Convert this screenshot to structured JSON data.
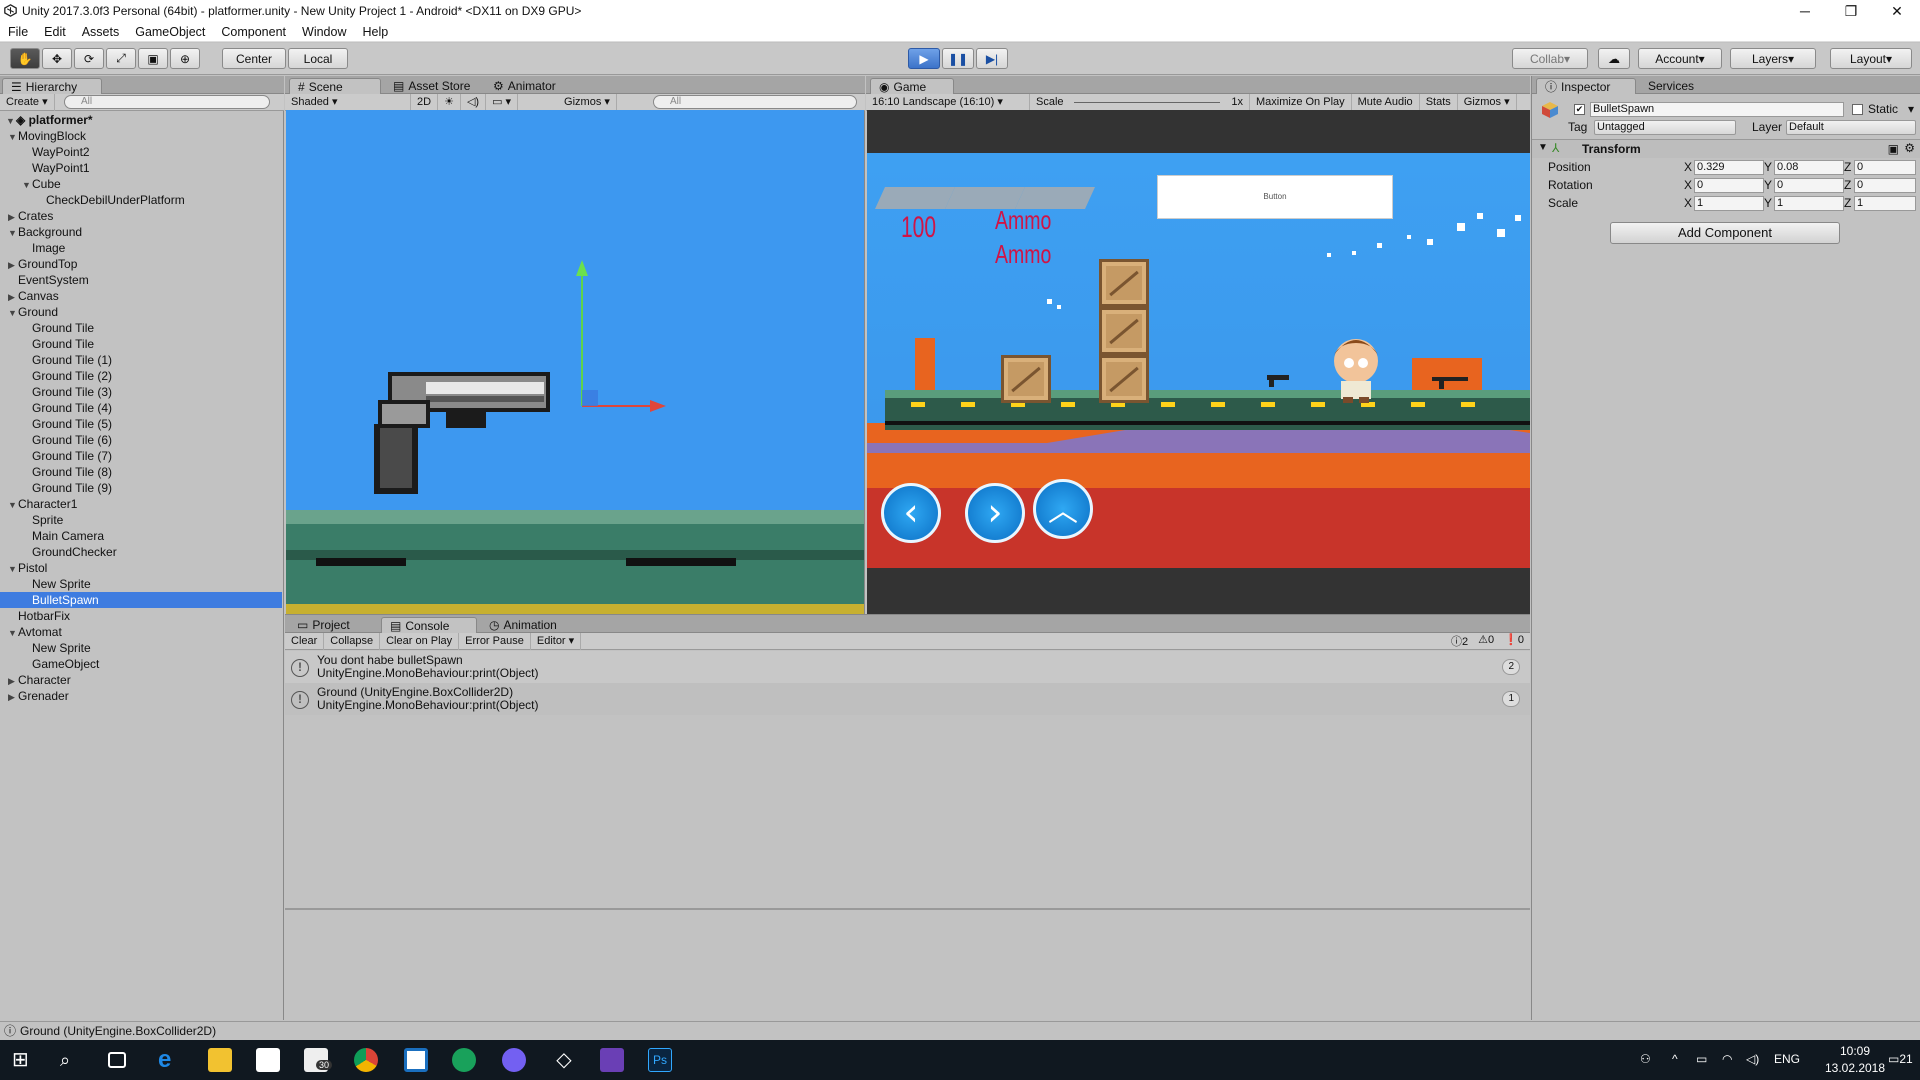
{
  "window": {
    "title": "Unity 2017.3.0f3 Personal (64bit) - platformer.unity - New Unity Project 1 - Android* <DX11 on DX9 GPU>",
    "controls": [
      "─",
      "❐",
      "✕"
    ]
  },
  "menu": [
    "File",
    "Edit",
    "Assets",
    "GameObject",
    "Component",
    "Window",
    "Help"
  ],
  "toolbar": {
    "pivot": "Center",
    "space": "Local",
    "collab": "Collab",
    "account": "Account",
    "layers": "Layers",
    "layout": "Layout"
  },
  "hierarchy": {
    "tab": "Hierarchy",
    "create": "Create",
    "search_placeholder": "All",
    "scene_name": "platformer*",
    "items": [
      {
        "label": "MovingBlock",
        "depth": 1,
        "arrow": "down"
      },
      {
        "label": "WayPoint2",
        "depth": 2,
        "arrow": ""
      },
      {
        "label": "WayPoint1",
        "depth": 2,
        "arrow": ""
      },
      {
        "label": "Cube",
        "depth": 2,
        "arrow": "down"
      },
      {
        "label": "CheckDebilUnderPlatform",
        "depth": 3,
        "arrow": ""
      },
      {
        "label": "Crates",
        "depth": 1,
        "arrow": "right"
      },
      {
        "label": "Background",
        "depth": 1,
        "arrow": "down"
      },
      {
        "label": "Image",
        "depth": 2,
        "arrow": ""
      },
      {
        "label": "GroundTop",
        "depth": 1,
        "arrow": "right"
      },
      {
        "label": "EventSystem",
        "depth": 1,
        "arrow": ""
      },
      {
        "label": "Canvas",
        "depth": 1,
        "arrow": "right"
      },
      {
        "label": "Ground",
        "depth": 1,
        "arrow": "down"
      },
      {
        "label": "Ground Tile",
        "depth": 2,
        "arrow": ""
      },
      {
        "label": "Ground Tile",
        "depth": 2,
        "arrow": ""
      },
      {
        "label": "Ground Tile (1)",
        "depth": 2,
        "arrow": ""
      },
      {
        "label": "Ground Tile (2)",
        "depth": 2,
        "arrow": ""
      },
      {
        "label": "Ground Tile (3)",
        "depth": 2,
        "arrow": ""
      },
      {
        "label": "Ground Tile (4)",
        "depth": 2,
        "arrow": ""
      },
      {
        "label": "Ground Tile (5)",
        "depth": 2,
        "arrow": ""
      },
      {
        "label": "Ground Tile (6)",
        "depth": 2,
        "arrow": ""
      },
      {
        "label": "Ground Tile (7)",
        "depth": 2,
        "arrow": ""
      },
      {
        "label": "Ground Tile (8)",
        "depth": 2,
        "arrow": ""
      },
      {
        "label": "Ground Tile (9)",
        "depth": 2,
        "arrow": ""
      },
      {
        "label": "Character1",
        "depth": 1,
        "arrow": "down"
      },
      {
        "label": "Sprite",
        "depth": 2,
        "arrow": ""
      },
      {
        "label": "Main Camera",
        "depth": 2,
        "arrow": ""
      },
      {
        "label": "GroundChecker",
        "depth": 2,
        "arrow": ""
      },
      {
        "label": "Pistol",
        "depth": 1,
        "arrow": "down"
      },
      {
        "label": "New Sprite",
        "depth": 2,
        "arrow": ""
      },
      {
        "label": "BulletSpawn",
        "depth": 2,
        "arrow": "",
        "selected": true
      },
      {
        "label": "HotbarFix",
        "depth": 1,
        "arrow": ""
      },
      {
        "label": "Avtomat",
        "depth": 1,
        "arrow": "down"
      },
      {
        "label": "New Sprite",
        "depth": 2,
        "arrow": ""
      },
      {
        "label": "GameObject",
        "depth": 2,
        "arrow": ""
      },
      {
        "label": "Character",
        "depth": 1,
        "arrow": "right"
      },
      {
        "label": "Grenader",
        "depth": 1,
        "arrow": "right"
      }
    ]
  },
  "scene": {
    "tabs": [
      "Scene",
      "Asset Store",
      "Animator"
    ],
    "shading": "Shaded",
    "mode2d": "2D",
    "gizmos": "Gizmos",
    "search_placeholder": "All"
  },
  "game": {
    "tab": "Game",
    "aspect": "16:10 Landscape (16:10)",
    "scale_label": "Scale",
    "scale_value": "1x",
    "maximize": "Maximize On Play",
    "mute": "Mute Audio",
    "stats": "Stats",
    "gizmos": "Gizmos",
    "hud_health": "100",
    "hud_ammo1": "Ammo",
    "hud_ammo2": "Ammo",
    "button_text": "Button"
  },
  "console": {
    "tabs": [
      "Project",
      "Console",
      "Animation"
    ],
    "toolbar": [
      "Clear",
      "Collapse",
      "Clear on Play",
      "Error Pause",
      "Editor"
    ],
    "counts": {
      "info": "2",
      "warn": "0",
      "error": "0"
    },
    "entries": [
      {
        "line1": "You dont habe bulletSpawn",
        "line2": "UnityEngine.MonoBehaviour:print(Object)",
        "count": "2"
      },
      {
        "line1": "Ground (UnityEngine.BoxCollider2D)",
        "line2": "UnityEngine.MonoBehaviour:print(Object)",
        "count": "1"
      }
    ]
  },
  "inspector": {
    "tabs": [
      "Inspector",
      "Services"
    ],
    "object_name": "BulletSpawn",
    "static_label": "Static",
    "tag_label": "Tag",
    "tag_value": "Untagged",
    "layer_label": "Layer",
    "layer_value": "Default",
    "component": "Transform",
    "rows": [
      {
        "label": "Position",
        "x": "0.329",
        "y": "0.08",
        "z": "0"
      },
      {
        "label": "Rotation",
        "x": "0",
        "y": "0",
        "z": "0"
      },
      {
        "label": "Scale",
        "x": "1",
        "y": "1",
        "z": "1"
      }
    ],
    "add_component": "Add Component"
  },
  "status": "Ground (UnityEngine.BoxCollider2D)",
  "taskbar": {
    "lang": "ENG",
    "time": "10:09",
    "date": "13.02.2018",
    "notif": "21",
    "mail_badge": "30"
  }
}
